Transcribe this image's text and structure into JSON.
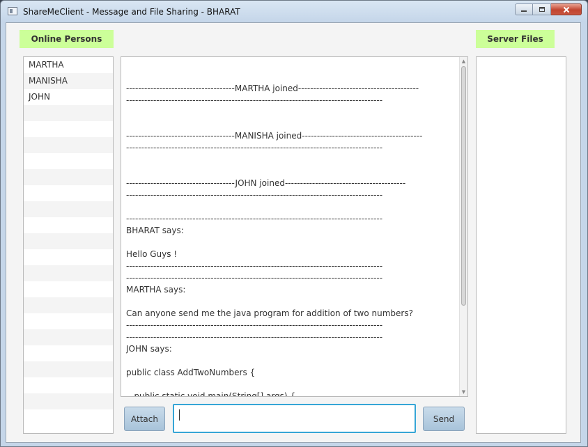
{
  "window": {
    "title": "ShareMeClient - Message and File Sharing - BHARAT",
    "minimize_icon": "minimize-icon",
    "maximize_icon": "maximize-icon",
    "close_icon": "close-icon"
  },
  "online_persons": {
    "header": "Online Persons",
    "items": [
      "MARTHA",
      "MANISHA",
      "JOHN"
    ]
  },
  "server_files": {
    "header": "Server Files",
    "items": []
  },
  "chat": {
    "lines": [
      "------------------------------------MARTHA joined----------------------------------------",
      "-------------------------------------------------------------------------------------",
      "",
      "",
      "------------------------------------MANISHA joined----------------------------------------",
      "-------------------------------------------------------------------------------------",
      "",
      "",
      "------------------------------------JOHN joined----------------------------------------",
      "-------------------------------------------------------------------------------------",
      "",
      "-------------------------------------------------------------------------------------",
      "BHARAT says:",
      "",
      "Hello Guys !",
      "-------------------------------------------------------------------------------------",
      "-------------------------------------------------------------------------------------",
      "MARTHA says:",
      "",
      "Can anyone send me the java program for addition of two numbers?",
      "-------------------------------------------------------------------------------------",
      "-------------------------------------------------------------------------------------",
      "JOHN says:",
      "",
      "public class AddTwoNumbers {",
      "",
      "   public static void main(String[] args) {"
    ]
  },
  "controls": {
    "attach_label": "Attach",
    "send_label": "Send",
    "message_value": ""
  },
  "colors": {
    "header_bg": "#ccff99",
    "focus_border": "#35a5d6"
  }
}
